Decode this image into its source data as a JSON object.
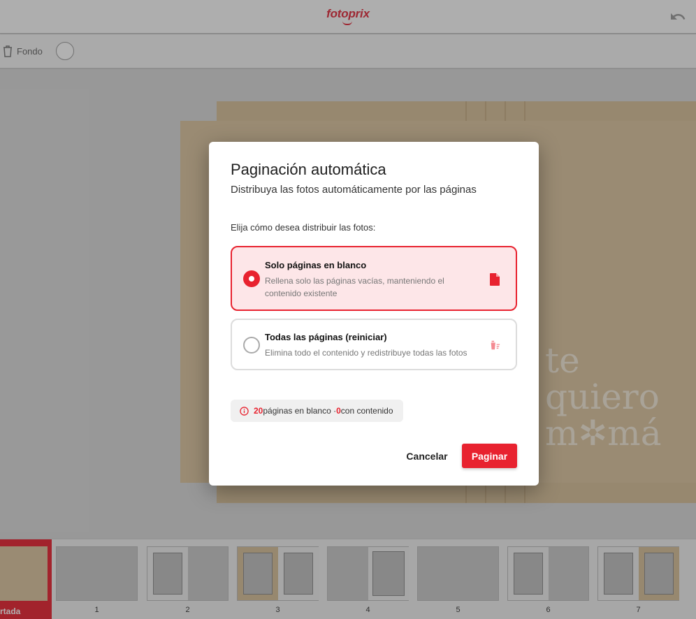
{
  "app": {
    "logo_text": "fotoprix",
    "brand_color": "#e8222f"
  },
  "toolbar": {
    "fondo_label": "Fondo"
  },
  "canvas": {
    "art_text_lines": [
      "te",
      "quiero",
      "m✲má"
    ]
  },
  "thumbnails": {
    "cover_label": "rtada",
    "pages": [
      "1",
      "2",
      "3",
      "4",
      "5",
      "6",
      "7"
    ]
  },
  "modal": {
    "title": "Paginación automática",
    "subtitle": "Distribuya las fotos automáticamente por las páginas",
    "prompt": "Elija cómo desea distribuir las fotos:",
    "options": [
      {
        "title": "Solo páginas en blanco",
        "description": "Rellena solo las páginas vacías, manteniendo el contenido existente",
        "icon": "file-icon",
        "selected": true
      },
      {
        "title": "Todas las páginas (reiniciar)",
        "description": "Elimina todo el contenido y redistribuye todas las fotos",
        "icon": "delete-sweep-icon",
        "selected": false
      }
    ],
    "status": {
      "blank_count": "20",
      "blank_label": "páginas en blanco · ",
      "content_count": "0",
      "content_label": "con contenido"
    },
    "cancel_label": "Cancelar",
    "confirm_label": "Paginar"
  }
}
